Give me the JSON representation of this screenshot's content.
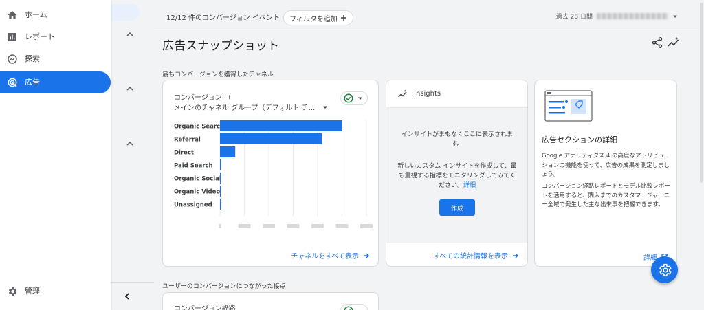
{
  "nav": {
    "items": [
      {
        "label": "ホーム",
        "icon": "home-icon"
      },
      {
        "label": "レポート",
        "icon": "reports-icon"
      },
      {
        "label": "探索",
        "icon": "explore-icon"
      },
      {
        "label": "広告",
        "icon": "advertising-icon",
        "active": true
      }
    ],
    "admin_label": "管理"
  },
  "topbar": {
    "conversion_selector": "12/12 件のコンバージョン イベント",
    "filter_button": "フィルタを追加",
    "date_range": "過去 28 日間"
  },
  "page": {
    "title": "広告スナップショット",
    "section1_label": "最もコンバージョンを獲得したチャネル",
    "section2_label": "ユーザーのコンバージョンにつながった接点"
  },
  "chart_card": {
    "metric_label": "コンバージョン",
    "metric_suffix": "（",
    "dimension_label": "メインのチャネル グループ（デフォルト チ...",
    "view_all_link": "チャネルをすべて表示"
  },
  "chart_data": {
    "type": "bar",
    "orientation": "horizontal",
    "categories": [
      "Organic Search",
      "Referral",
      "Direct",
      "Paid Search",
      "Organic Social",
      "Organic Video",
      "Unassigned"
    ],
    "values": [
      100,
      83.5,
      12.5,
      0.5,
      0.5,
      0.5,
      0.5
    ],
    "xlim": [
      0,
      120
    ],
    "grid": true,
    "bar_color": "#1a73e8"
  },
  "insights_card": {
    "title": "Insights",
    "line1": "インサイトがまもなくここに表示されます。",
    "line2": "新しいカスタム インサイトを作成して、最も重視する指標をモニタリングしてみてください。",
    "detail_link": "詳細",
    "create_button": "作成",
    "view_all_link": "すべての統計情報を表示"
  },
  "ad_card": {
    "title": "広告セクションの詳細",
    "p1": "Google アナリティクス 4 の高度なアトリビューションの機能を使って、広告の成果を測定しましょう。",
    "p2": "コンバージョン経路レポートとモデル比較レポートを活用すると、購入までのカスタマージャーニー全域で発生した主な出来事を把握できます。",
    "detail_link": "詳細"
  },
  "path_card": {
    "title": "コンバージョン経路"
  },
  "colors": {
    "accent": "#1a73e8",
    "success": "#188038"
  }
}
